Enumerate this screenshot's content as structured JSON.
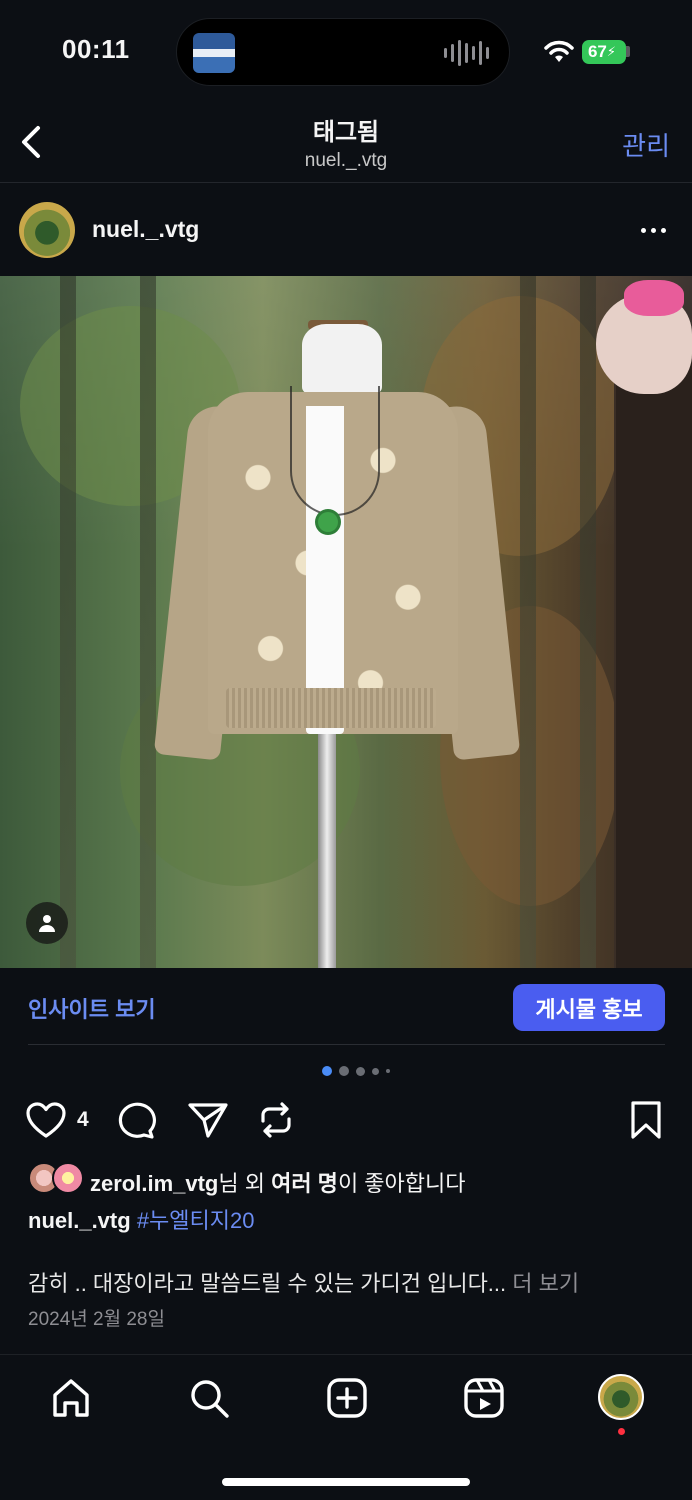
{
  "status_bar": {
    "time": "00:11",
    "battery": "67",
    "icons": [
      "wifi-icon",
      "battery-charging-icon",
      "audio-wave-icon"
    ]
  },
  "header": {
    "title": "태그됨",
    "subtitle": "nuel._.vtg",
    "manage_label": "관리"
  },
  "post": {
    "username": "nuel._.vtg",
    "photo_alt_icon": "tagged-person-icon",
    "insights_label": "인사이트 보기",
    "promote_label": "게시물 홍보",
    "carousel": {
      "count": 5,
      "active_index": 0
    },
    "like_count": "4",
    "likes": {
      "liker": "zerol.im_vtg",
      "suffix_1": "님 외 ",
      "others": "여러 명",
      "suffix_2": "이 좋아합니다"
    },
    "caption": {
      "username": "nuel._.vtg",
      "hashtag": "#누엘티지20",
      "body": "감히 .. 대장이라고 말씀드릴 수 있는 가디건 입니다...",
      "more": " 더 보기"
    },
    "date": "2024년 2월 28일"
  },
  "bottom_nav": [
    "home-icon",
    "search-icon",
    "create-icon",
    "reels-icon",
    "profile-avatar"
  ],
  "colors": {
    "background": "#0c0f14",
    "link": "#6b8cf2",
    "promote_button": "#4a5df0",
    "battery": "#34c759",
    "notification": "#ff3040"
  }
}
